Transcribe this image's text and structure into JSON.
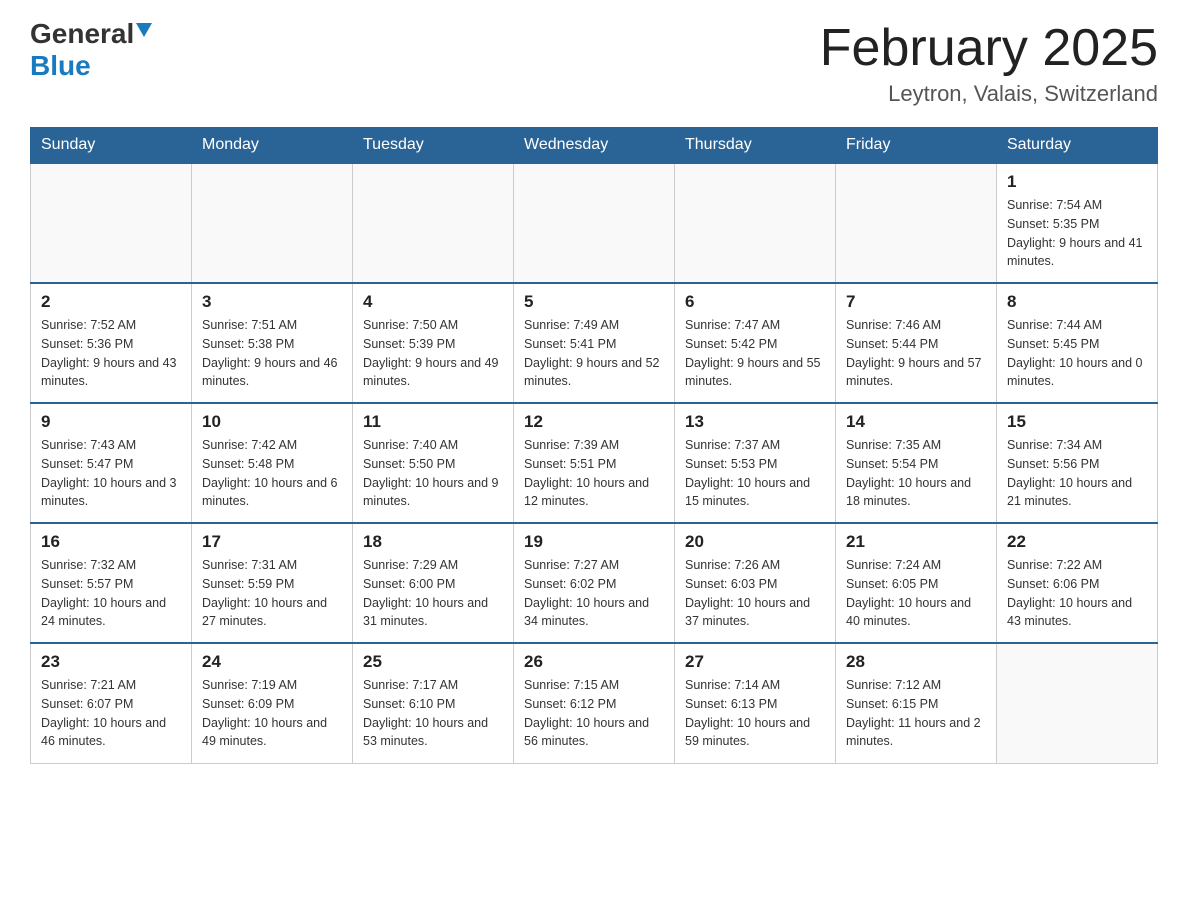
{
  "header": {
    "logo_general": "General",
    "logo_blue": "Blue",
    "month_title": "February 2025",
    "location": "Leytron, Valais, Switzerland"
  },
  "weekdays": [
    "Sunday",
    "Monday",
    "Tuesday",
    "Wednesday",
    "Thursday",
    "Friday",
    "Saturday"
  ],
  "weeks": [
    [
      {
        "day": "",
        "info": ""
      },
      {
        "day": "",
        "info": ""
      },
      {
        "day": "",
        "info": ""
      },
      {
        "day": "",
        "info": ""
      },
      {
        "day": "",
        "info": ""
      },
      {
        "day": "",
        "info": ""
      },
      {
        "day": "1",
        "info": "Sunrise: 7:54 AM\nSunset: 5:35 PM\nDaylight: 9 hours and 41 minutes."
      }
    ],
    [
      {
        "day": "2",
        "info": "Sunrise: 7:52 AM\nSunset: 5:36 PM\nDaylight: 9 hours and 43 minutes."
      },
      {
        "day": "3",
        "info": "Sunrise: 7:51 AM\nSunset: 5:38 PM\nDaylight: 9 hours and 46 minutes."
      },
      {
        "day": "4",
        "info": "Sunrise: 7:50 AM\nSunset: 5:39 PM\nDaylight: 9 hours and 49 minutes."
      },
      {
        "day": "5",
        "info": "Sunrise: 7:49 AM\nSunset: 5:41 PM\nDaylight: 9 hours and 52 minutes."
      },
      {
        "day": "6",
        "info": "Sunrise: 7:47 AM\nSunset: 5:42 PM\nDaylight: 9 hours and 55 minutes."
      },
      {
        "day": "7",
        "info": "Sunrise: 7:46 AM\nSunset: 5:44 PM\nDaylight: 9 hours and 57 minutes."
      },
      {
        "day": "8",
        "info": "Sunrise: 7:44 AM\nSunset: 5:45 PM\nDaylight: 10 hours and 0 minutes."
      }
    ],
    [
      {
        "day": "9",
        "info": "Sunrise: 7:43 AM\nSunset: 5:47 PM\nDaylight: 10 hours and 3 minutes."
      },
      {
        "day": "10",
        "info": "Sunrise: 7:42 AM\nSunset: 5:48 PM\nDaylight: 10 hours and 6 minutes."
      },
      {
        "day": "11",
        "info": "Sunrise: 7:40 AM\nSunset: 5:50 PM\nDaylight: 10 hours and 9 minutes."
      },
      {
        "day": "12",
        "info": "Sunrise: 7:39 AM\nSunset: 5:51 PM\nDaylight: 10 hours and 12 minutes."
      },
      {
        "day": "13",
        "info": "Sunrise: 7:37 AM\nSunset: 5:53 PM\nDaylight: 10 hours and 15 minutes."
      },
      {
        "day": "14",
        "info": "Sunrise: 7:35 AM\nSunset: 5:54 PM\nDaylight: 10 hours and 18 minutes."
      },
      {
        "day": "15",
        "info": "Sunrise: 7:34 AM\nSunset: 5:56 PM\nDaylight: 10 hours and 21 minutes."
      }
    ],
    [
      {
        "day": "16",
        "info": "Sunrise: 7:32 AM\nSunset: 5:57 PM\nDaylight: 10 hours and 24 minutes."
      },
      {
        "day": "17",
        "info": "Sunrise: 7:31 AM\nSunset: 5:59 PM\nDaylight: 10 hours and 27 minutes."
      },
      {
        "day": "18",
        "info": "Sunrise: 7:29 AM\nSunset: 6:00 PM\nDaylight: 10 hours and 31 minutes."
      },
      {
        "day": "19",
        "info": "Sunrise: 7:27 AM\nSunset: 6:02 PM\nDaylight: 10 hours and 34 minutes."
      },
      {
        "day": "20",
        "info": "Sunrise: 7:26 AM\nSunset: 6:03 PM\nDaylight: 10 hours and 37 minutes."
      },
      {
        "day": "21",
        "info": "Sunrise: 7:24 AM\nSunset: 6:05 PM\nDaylight: 10 hours and 40 minutes."
      },
      {
        "day": "22",
        "info": "Sunrise: 7:22 AM\nSunset: 6:06 PM\nDaylight: 10 hours and 43 minutes."
      }
    ],
    [
      {
        "day": "23",
        "info": "Sunrise: 7:21 AM\nSunset: 6:07 PM\nDaylight: 10 hours and 46 minutes."
      },
      {
        "day": "24",
        "info": "Sunrise: 7:19 AM\nSunset: 6:09 PM\nDaylight: 10 hours and 49 minutes."
      },
      {
        "day": "25",
        "info": "Sunrise: 7:17 AM\nSunset: 6:10 PM\nDaylight: 10 hours and 53 minutes."
      },
      {
        "day": "26",
        "info": "Sunrise: 7:15 AM\nSunset: 6:12 PM\nDaylight: 10 hours and 56 minutes."
      },
      {
        "day": "27",
        "info": "Sunrise: 7:14 AM\nSunset: 6:13 PM\nDaylight: 10 hours and 59 minutes."
      },
      {
        "day": "28",
        "info": "Sunrise: 7:12 AM\nSunset: 6:15 PM\nDaylight: 11 hours and 2 minutes."
      },
      {
        "day": "",
        "info": ""
      }
    ]
  ]
}
